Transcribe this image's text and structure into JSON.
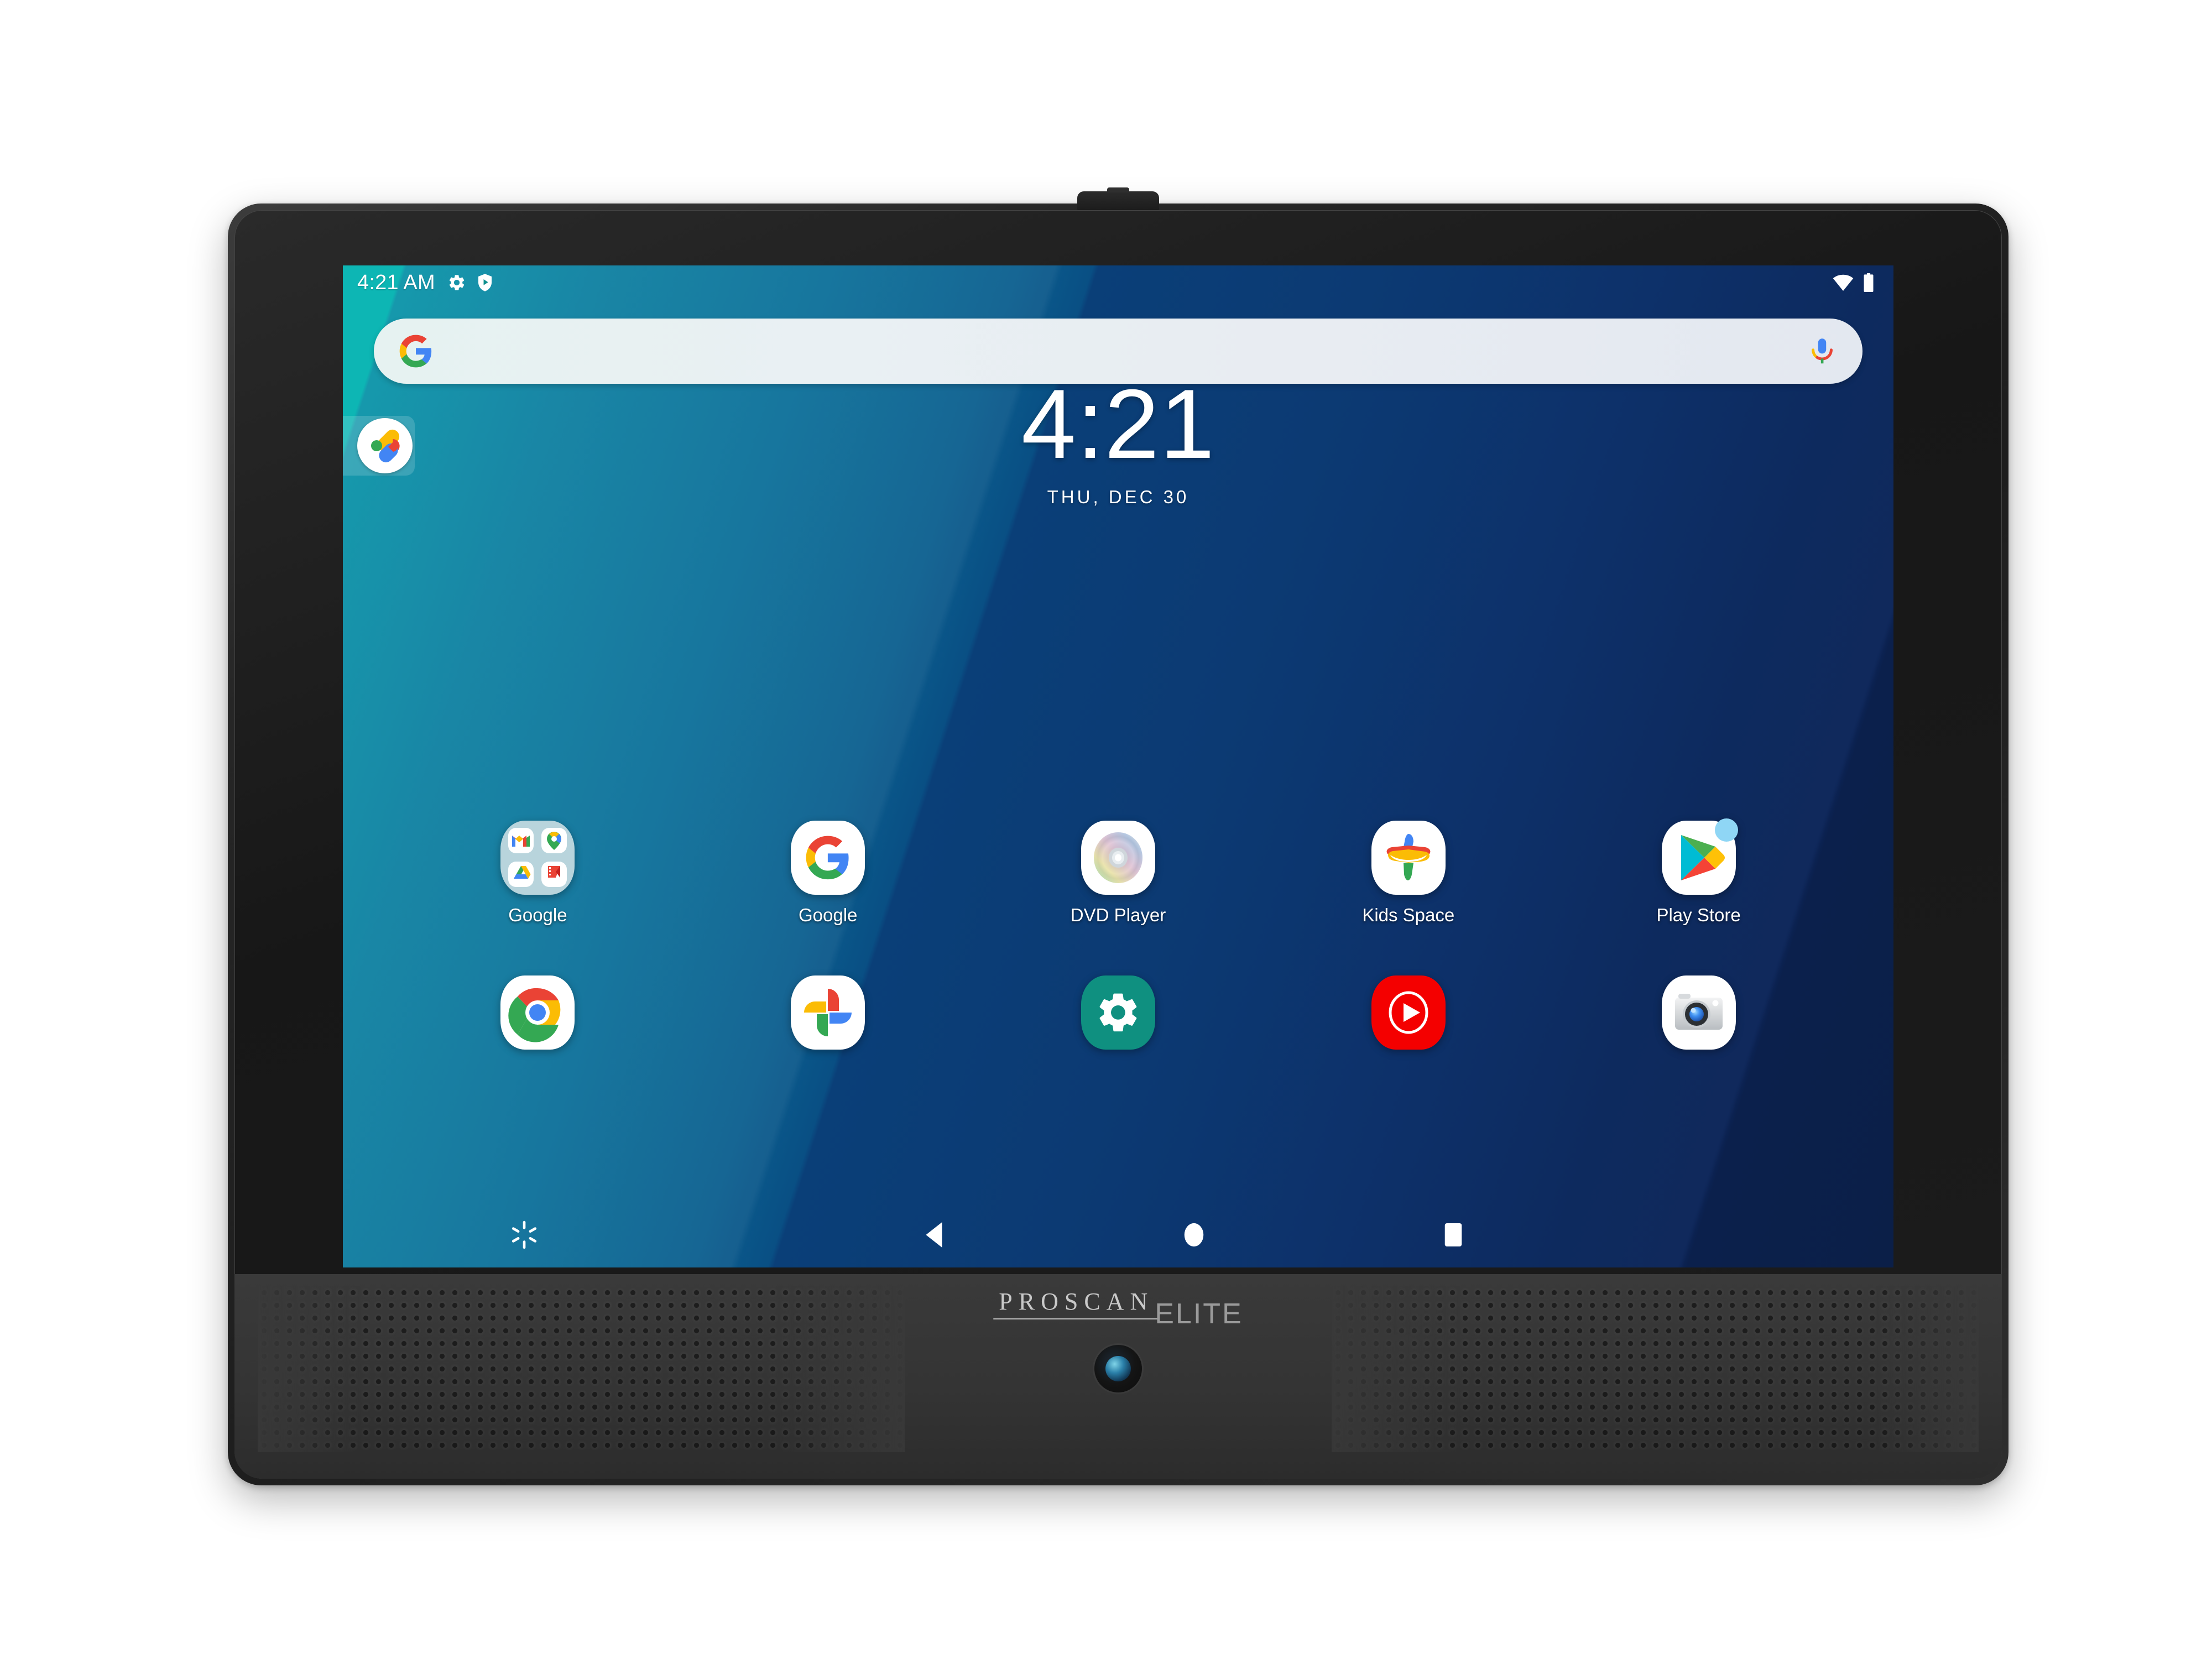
{
  "device": {
    "brand_primary": "PROSCAN",
    "brand_secondary": "ELITE"
  },
  "status_bar": {
    "clock": "4:21 AM",
    "left_icons": [
      "gear-icon",
      "play-protect-shield-icon"
    ],
    "right_icons": [
      "wifi-icon",
      "battery-full-icon"
    ]
  },
  "search": {
    "placeholder": "",
    "value": "",
    "leading_icon": "google-g-icon",
    "trailing_icon": "google-assistant-mic-icon"
  },
  "entertainment_chip": {
    "icon": "google-entertainment-space-icon"
  },
  "clock_widget": {
    "time": "4:21",
    "date": "THU, DEC 30"
  },
  "home_screen": {
    "rows": [
      {
        "apps": [
          {
            "label": "Google",
            "icon": "google-folder-icon",
            "badge": false
          },
          {
            "label": "Google",
            "icon": "google-search-icon",
            "badge": false
          },
          {
            "label": "DVD Player",
            "icon": "dvd-disc-icon",
            "badge": false
          },
          {
            "label": "Kids Space",
            "icon": "kids-space-icon",
            "badge": false
          },
          {
            "label": "Play Store",
            "icon": "play-store-icon",
            "badge": true
          }
        ]
      },
      {
        "apps": [
          {
            "label": "",
            "icon": "chrome-icon",
            "badge": false
          },
          {
            "label": "",
            "icon": "google-photos-icon",
            "badge": false
          },
          {
            "label": "",
            "icon": "settings-gear-icon",
            "badge": false
          },
          {
            "label": "",
            "icon": "youtube-music-icon",
            "badge": false
          },
          {
            "label": "",
            "icon": "camera-icon",
            "badge": false
          }
        ]
      }
    ]
  },
  "nav_bar": {
    "buttons": [
      {
        "name": "brightness",
        "icon": "brightness-sparkle-icon"
      },
      {
        "name": "back",
        "icon": "back-triangle-icon"
      },
      {
        "name": "home",
        "icon": "home-circle-icon"
      },
      {
        "name": "recents",
        "icon": "recents-square-icon"
      }
    ]
  },
  "colors": {
    "wallpaper_start": "#00b2b0",
    "wallpaper_end": "#0c2352",
    "badge": "#8fd6f5",
    "settings_teal": "#0f9080",
    "youtube_red": "#f40000",
    "google_blue": "#4285f4",
    "google_red": "#ea4335",
    "google_yellow": "#fbbc05",
    "google_green": "#34a853"
  }
}
